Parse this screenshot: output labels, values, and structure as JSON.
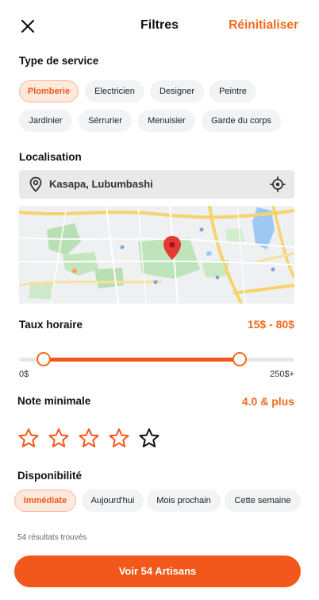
{
  "header": {
    "title": "Filtres",
    "reset_label": "Réinitialiser"
  },
  "service_type": {
    "title": "Type de service",
    "options": [
      {
        "label": "Plomberie",
        "selected": true
      },
      {
        "label": "Electricien",
        "selected": false
      },
      {
        "label": "Designer",
        "selected": false
      },
      {
        "label": "Peintre",
        "selected": false
      },
      {
        "label": "Jardinier",
        "selected": false
      },
      {
        "label": "Sérrurier",
        "selected": false
      },
      {
        "label": "Menuisier",
        "selected": false
      },
      {
        "label": "Garde du corps",
        "selected": false
      }
    ]
  },
  "location": {
    "title": "Localisation",
    "value": "Kasapa, Lubumbashi",
    "pin_icon": "map-pin-icon",
    "locate_icon": "crosshair-icon"
  },
  "hourly_rate": {
    "title": "Taux horaire",
    "value": "15$ - 80$",
    "min_label": "0$",
    "max_label": "250$+",
    "range_start_fraction": 0.09,
    "range_end_fraction": 0.8
  },
  "rating": {
    "title": "Note minimale",
    "value": "4.0 & plus",
    "stars": [
      {
        "active": true
      },
      {
        "active": true
      },
      {
        "active": true
      },
      {
        "active": true
      },
      {
        "active": false
      }
    ]
  },
  "availability": {
    "title": "Disponibilité",
    "options": [
      {
        "label": "Immédiate",
        "selected": true
      },
      {
        "label": "Aujourd'hui",
        "selected": false
      },
      {
        "label": "Mois prochain",
        "selected": false
      },
      {
        "label": "Cette semaine",
        "selected": false
      }
    ]
  },
  "results": {
    "count_text": "54 résultats trouvés",
    "cta_label": "Voir 54 Artisans"
  },
  "colors": {
    "accent": "#f2581b",
    "accent_light": "#ffe9dd",
    "chip_bg": "#f2f3f5"
  }
}
